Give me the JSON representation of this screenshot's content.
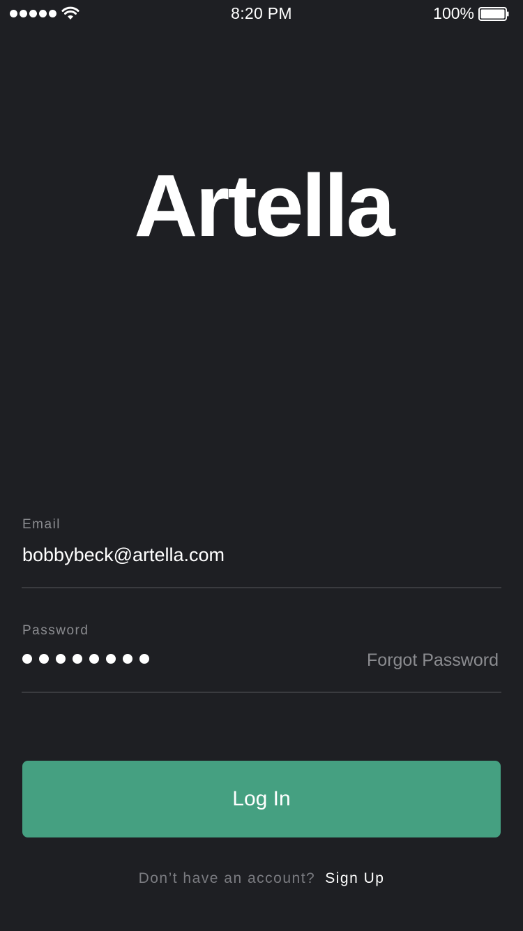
{
  "status_bar": {
    "time": "8:20 PM",
    "battery_percent": "100%",
    "signal_icon": "signal-dots-icon",
    "wifi_icon": "wifi-icon",
    "battery_icon": "battery-icon"
  },
  "logo": {
    "text": "Artella"
  },
  "form": {
    "email": {
      "label": "Email",
      "value": "bobbybeck@artella.com"
    },
    "password": {
      "label": "Password",
      "masked_length": 8,
      "forgot_label": "Forgot Password"
    }
  },
  "login_button": {
    "label": "Log In",
    "color": "#45a081"
  },
  "signup": {
    "prompt": "Don’t have an account?",
    "link": "Sign Up"
  },
  "colors": {
    "background": "#1e1f23",
    "muted_text": "#8b8c90",
    "accent": "#45a081"
  }
}
